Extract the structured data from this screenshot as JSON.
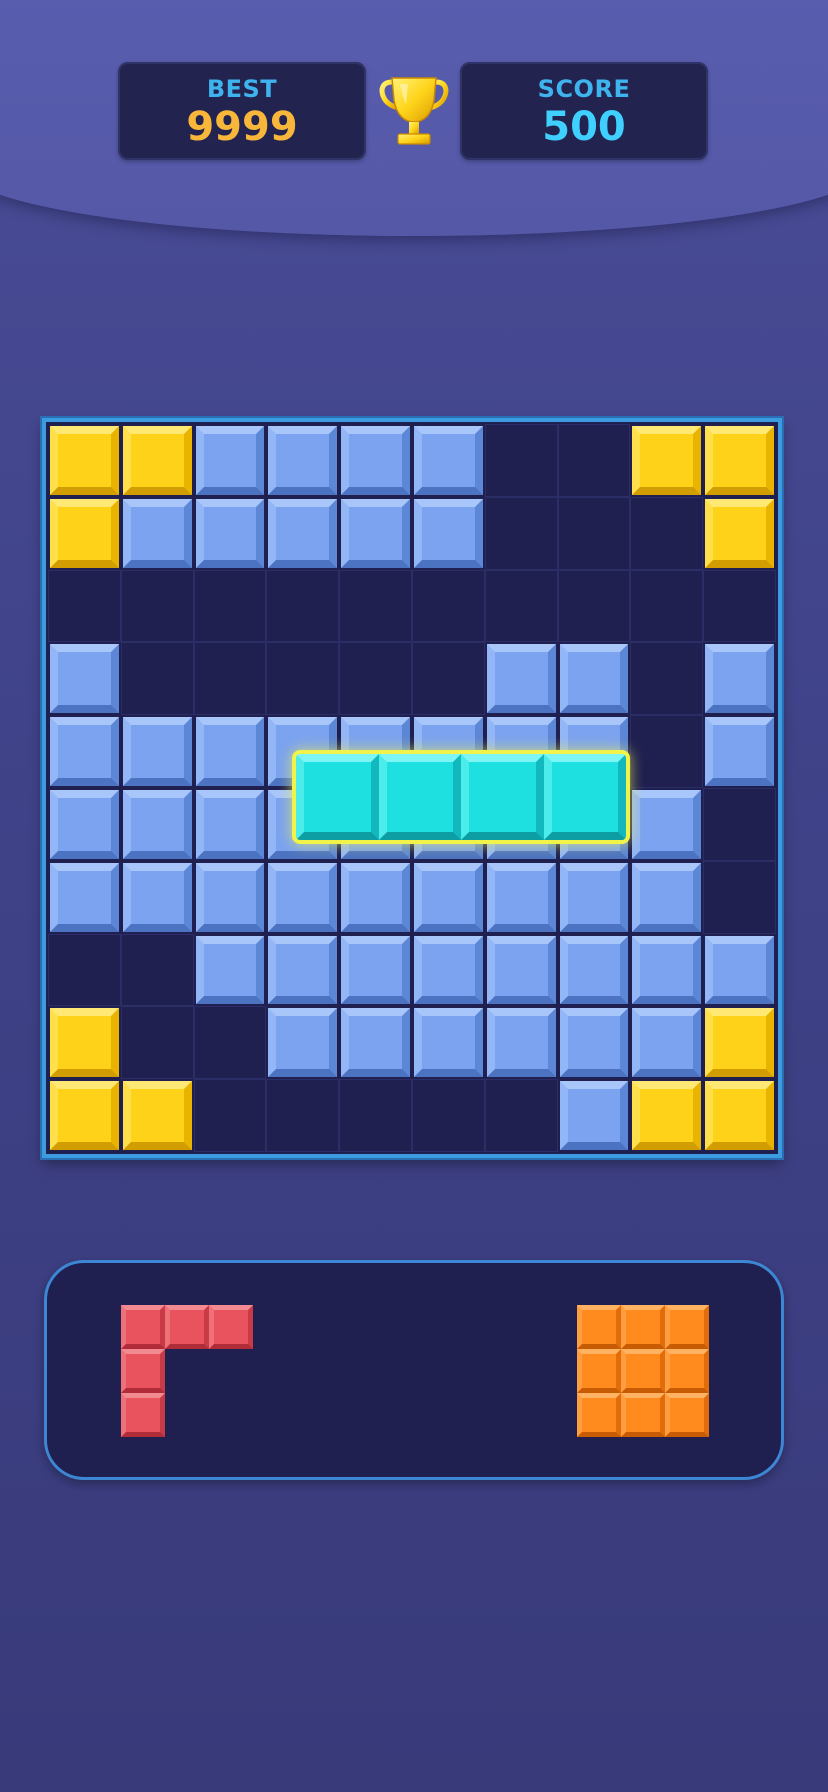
{
  "header": {
    "best_label": "BEST",
    "best_value": "9999",
    "score_label": "SCORE",
    "score_value": "500",
    "trophy_icon": "trophy-icon"
  },
  "colors": {
    "background": "#404389",
    "board_empty": "#1f2050",
    "board_border": "#3d9be0",
    "blue_block": "#7ba3ef",
    "yellow_block": "#ffd21a",
    "cyan_block": "#1fe0e0",
    "red_block": "#e8535e",
    "orange_block": "#ff8a1e",
    "highlight": "#f1f24a"
  },
  "board": {
    "size": 10,
    "rows": [
      "YYBBBB..YY",
      "YBBBBB...Y",
      "..........",
      "B.....BB.B",
      "BBBBBBBB.B",
      "BBBBBBBBB.",
      "BBBBBBBBB.",
      "..BBBBBBBB",
      "Y..BBBBBBY",
      "YY.....BYY"
    ],
    "legend": {
      "Y": "yellow",
      "B": "blue",
      ".": "empty"
    }
  },
  "dragging_piece": {
    "color": "cyan",
    "cells": 4,
    "orientation": "horizontal"
  },
  "tray": {
    "pieces": [
      {
        "name": "red-l-piece",
        "color": "red",
        "shape": [
          "XXX",
          "X..",
          "X.."
        ]
      },
      {
        "name": "orange-square-piece",
        "color": "orange",
        "shape": [
          "XXX",
          "XXX",
          "XXX"
        ]
      }
    ]
  }
}
